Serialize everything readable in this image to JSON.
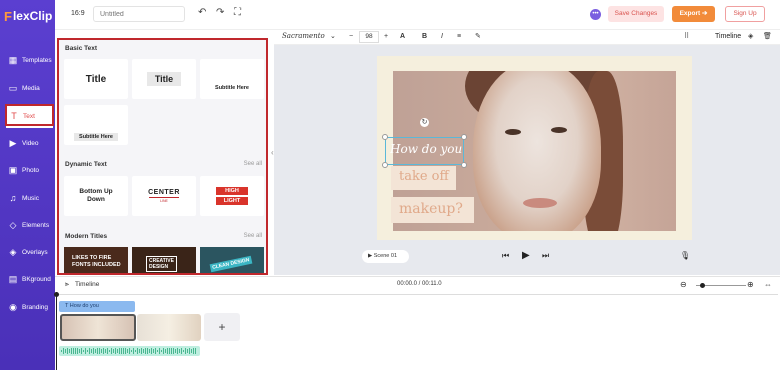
{
  "app": {
    "logo_mark": "F",
    "logo_text": "lexClip"
  },
  "sidebar": {
    "items": [
      {
        "label": "Templates",
        "icon": "templates-icon"
      },
      {
        "label": "Media",
        "icon": "media-icon"
      },
      {
        "label": "Text",
        "icon": "text-icon",
        "active": true
      },
      {
        "label": "Video",
        "icon": "video-icon"
      },
      {
        "label": "Photo",
        "icon": "photo-icon"
      },
      {
        "label": "Music",
        "icon": "music-icon"
      },
      {
        "label": "Elements",
        "icon": "elements-icon"
      },
      {
        "label": "Overlays",
        "icon": "overlays-icon"
      },
      {
        "label": "BKground",
        "icon": "background-icon"
      },
      {
        "label": "Branding",
        "icon": "branding-icon"
      }
    ]
  },
  "topbar": {
    "ratio": "16:9",
    "title_placeholder": "Untitled",
    "save_label": "Save Changes",
    "export_label": "Export",
    "signup_label": "Sign Up"
  },
  "panel": {
    "basic_title": "Basic Text",
    "basic_cards": [
      "Title",
      "Title",
      "Subtitle Here",
      "Subtitle Here"
    ],
    "dynamic_title": "Dynamic Text",
    "dynamic_see_all": "See all",
    "dynamic_cards": {
      "bud_1": "Bottom Up",
      "bud_2": "Down",
      "center": "CENTER",
      "center_line": "LINE",
      "high": "HIGH",
      "light": "LIGHT"
    },
    "modern_title": "Modern Titles",
    "modern_see_all": "See all",
    "modern_cards": {
      "m1a": "LIKES TO FIRE",
      "m1b": "FONTS INCLUDED",
      "m2a": "CREATIVE",
      "m2b": "DESIGN",
      "m3": "CLEAN DESIGN"
    }
  },
  "format": {
    "font": "Sacramento",
    "size": "98",
    "timeline_label": "Timeline"
  },
  "canvas": {
    "text_1": "How do you",
    "text_2": "take off",
    "text_3": "makeup?"
  },
  "player": {
    "scene_label": "Scene 01"
  },
  "timeline": {
    "label": "Timeline",
    "time": "00:00.0 / 00:11.0",
    "text_clip": "How do you",
    "zoom_level": 0.1,
    "colors": {
      "brand": "#5b3fd0",
      "export": "#f28b3a",
      "selection": "#5bb8d8"
    }
  }
}
